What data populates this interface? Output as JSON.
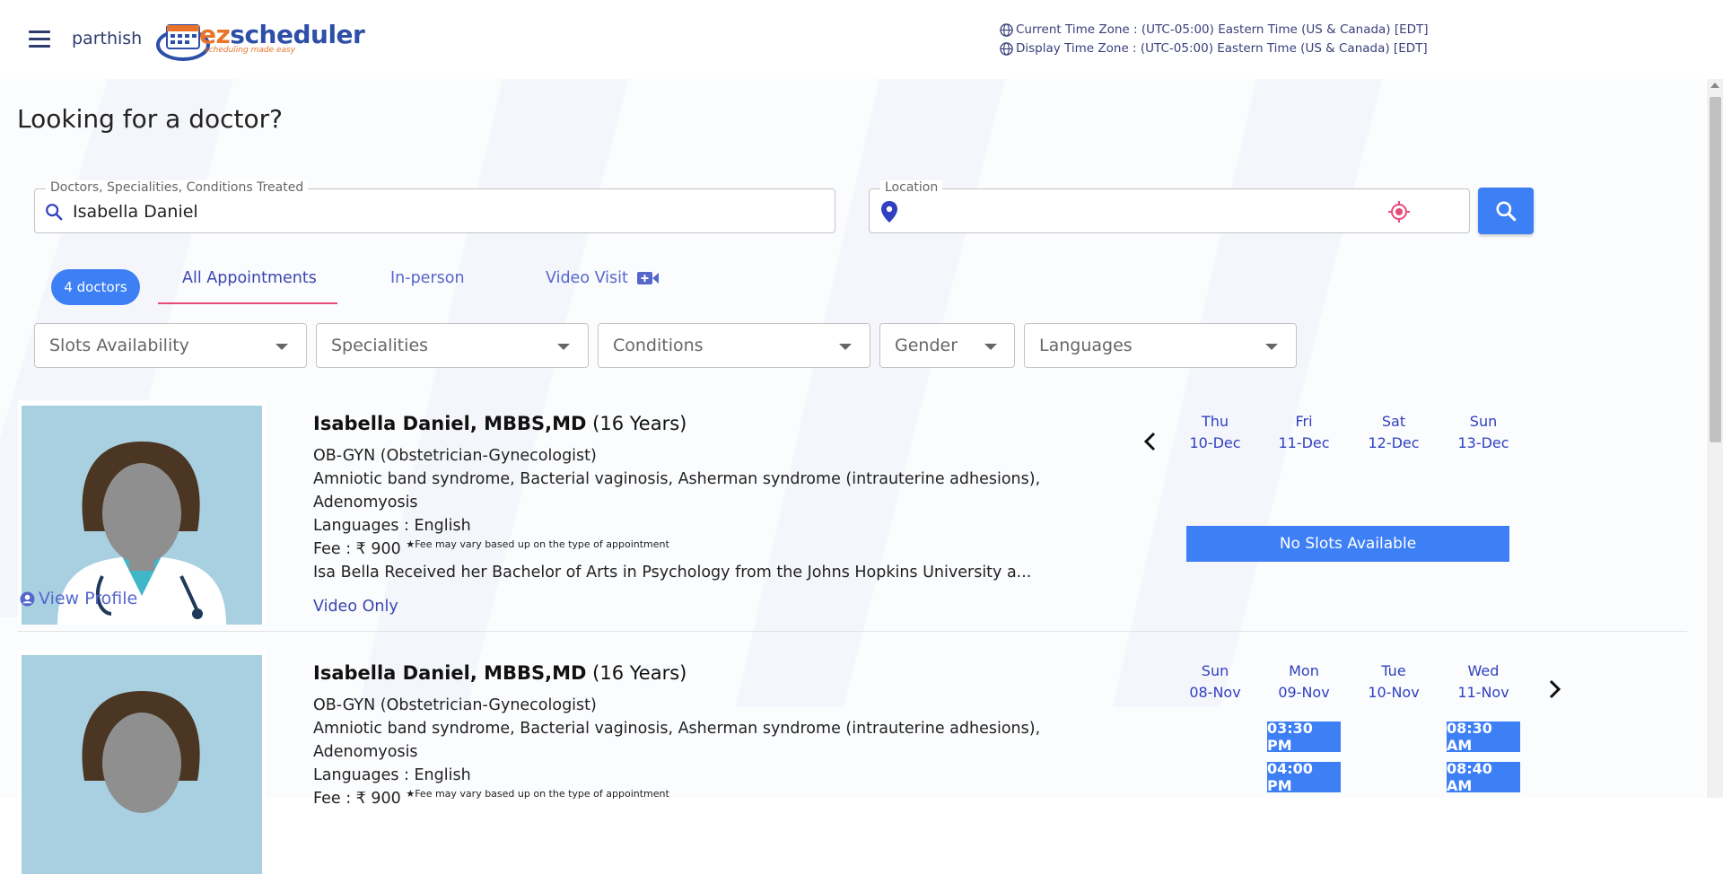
{
  "header": {
    "username": "parthish",
    "logo_brand_ez": "ez",
    "logo_brand_rest": "scheduler",
    "logo_tagline": "scheduling made easy",
    "current_tz": "Current Time Zone : (UTC-05:00) Eastern Time (US & Canada) [EDT]",
    "display_tz": "Display Time Zone : (UTC-05:00) Eastern Time (US & Canada) [EDT]"
  },
  "page": {
    "title": "Looking for a doctor?"
  },
  "search": {
    "query_label": "Doctors, Specialities, Conditions Treated",
    "query_value": "Isabella Daniel",
    "location_label": "Location",
    "location_value": ""
  },
  "tabs": {
    "count_badge": "4 doctors",
    "all": "All Appointments",
    "in_person": "In-person",
    "video": "Video Visit"
  },
  "filters": [
    "Slots Availability",
    "Specialities",
    "Conditions",
    "Gender",
    "Languages"
  ],
  "doctors": [
    {
      "name": "Isabella Daniel, MBBS,MD",
      "experience": "(16 Years)",
      "specialty": "OB-GYN (Obstetrician-Gynecologist)",
      "conditions_line1": "Amniotic band syndrome, Bacterial vaginosis, Asherman syndrome (intrauterine adhesions),",
      "conditions_line2": "Adenomyosis",
      "languages": "Languages : English",
      "fee": "Fee : ₹ 900",
      "fee_note": "★Fee may vary based up on the type of appointment",
      "bio": "Isa Bella Received her Bachelor of Arts in Psychology from the Johns Hopkins University a...",
      "visit_type": "Video Only",
      "view_profile": "View Profile",
      "days": [
        {
          "dow": "Thu",
          "date": "10-Dec"
        },
        {
          "dow": "Fri",
          "date": "11-Dec"
        },
        {
          "dow": "Sat",
          "date": "12-Dec"
        },
        {
          "dow": "Sun",
          "date": "13-Dec"
        }
      ],
      "no_slots": "No Slots Available"
    },
    {
      "name": "Isabella Daniel, MBBS,MD",
      "experience": "(16 Years)",
      "specialty": "OB-GYN (Obstetrician-Gynecologist)",
      "conditions_line1": "Amniotic band syndrome, Bacterial vaginosis, Asherman syndrome (intrauterine adhesions),",
      "conditions_line2": "Adenomyosis",
      "languages": "Languages : English",
      "fee": "Fee : ₹ 900",
      "fee_note": "★Fee may vary based up on the type of appointment",
      "days": [
        {
          "dow": "Sun",
          "date": "08-Nov"
        },
        {
          "dow": "Mon",
          "date": "09-Nov"
        },
        {
          "dow": "Tue",
          "date": "10-Nov"
        },
        {
          "dow": "Wed",
          "date": "11-Nov"
        }
      ],
      "slots": {
        "mon": [
          "03:30 PM",
          "04:00 PM"
        ],
        "wed": [
          "08:30 AM",
          "08:40 AM"
        ]
      }
    }
  ],
  "colors": {
    "primary": "#3d7ff5",
    "accent": "#e84b7a",
    "link": "#3a46b0"
  }
}
